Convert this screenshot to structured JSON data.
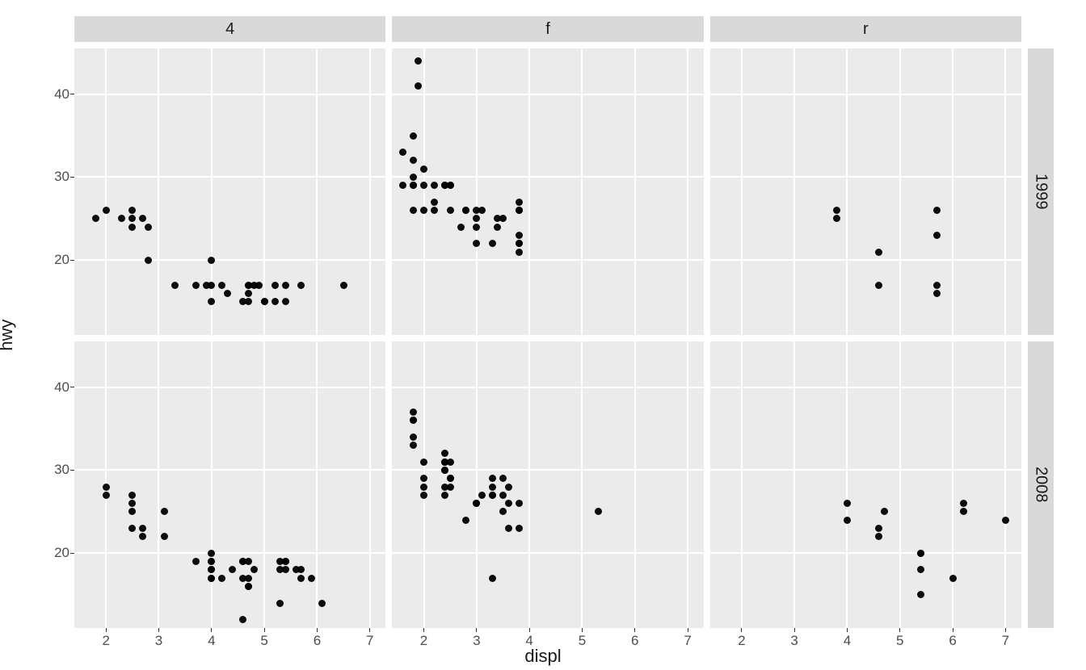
{
  "xlab": "displ",
  "ylab": "hwy",
  "strip_cols": [
    "4",
    "f",
    "r"
  ],
  "strip_rows": [
    "1999",
    "2008"
  ],
  "x_ticks": [
    2,
    3,
    4,
    5,
    6,
    7
  ],
  "y_ticks": [
    20,
    30,
    40
  ],
  "x_range": [
    1.4,
    7.3
  ],
  "y_range": [
    11,
    45.5
  ],
  "chart_data": [
    {
      "type": "scatter",
      "col": "4",
      "row": "1999",
      "xlabel": "displ",
      "ylabel": "hwy",
      "xlim": [
        1.4,
        7.3
      ],
      "ylim": [
        11,
        45.5
      ],
      "x": [
        1.8,
        2.0,
        2.3,
        2.5,
        2.5,
        2.5,
        2.7,
        2.8,
        2.8,
        3.3,
        3.7,
        3.9,
        4.0,
        4.0,
        4.0,
        4.2,
        4.3,
        4.6,
        4.7,
        4.7,
        4.7,
        4.7,
        5.0,
        5.2,
        5.2,
        5.4,
        5.4,
        5.7,
        6.5,
        4.8,
        4.9,
        5.0
      ],
      "y": [
        25,
        26,
        25,
        24,
        26,
        25,
        25,
        24,
        20,
        17,
        17,
        17,
        20,
        17,
        15,
        17,
        16,
        15,
        16,
        15,
        17,
        17,
        15,
        17,
        15,
        17,
        15,
        17,
        17,
        17,
        17,
        15
      ]
    },
    {
      "type": "scatter",
      "col": "f",
      "row": "1999",
      "xlabel": "displ",
      "ylabel": "hwy",
      "xlim": [
        1.4,
        7.3
      ],
      "ylim": [
        11,
        45.5
      ],
      "x": [
        1.6,
        1.6,
        1.8,
        1.8,
        1.8,
        1.8,
        1.8,
        1.8,
        1.8,
        1.9,
        1.9,
        2.0,
        2.0,
        2.0,
        2.2,
        2.2,
        2.2,
        2.4,
        2.4,
        2.5,
        2.5,
        2.5,
        2.7,
        2.8,
        2.8,
        3.0,
        3.0,
        3.0,
        3.0,
        3.1,
        3.3,
        3.4,
        3.4,
        3.5,
        3.8,
        3.8,
        3.8,
        3.8,
        3.8,
        3.8,
        3.8,
        3.8
      ],
      "y": [
        33,
        29,
        29,
        29,
        26,
        29,
        30,
        32,
        35,
        44,
        41,
        26,
        29,
        31,
        27,
        29,
        26,
        29,
        29,
        29,
        29,
        26,
        24,
        26,
        26,
        26,
        22,
        24,
        25,
        26,
        22,
        25,
        24,
        25,
        26,
        22,
        26,
        21,
        22,
        23,
        26,
        27
      ]
    },
    {
      "type": "scatter",
      "col": "r",
      "row": "1999",
      "xlabel": "displ",
      "ylabel": "hwy",
      "xlim": [
        1.4,
        7.3
      ],
      "ylim": [
        11,
        45.5
      ],
      "x": [
        3.8,
        3.8,
        4.6,
        4.6,
        5.7,
        5.7,
        5.7,
        5.7
      ],
      "y": [
        26,
        25,
        17,
        21,
        17,
        16,
        26,
        23
      ]
    },
    {
      "type": "scatter",
      "col": "4",
      "row": "2008",
      "xlabel": "displ",
      "ylabel": "hwy",
      "xlim": [
        1.4,
        7.3
      ],
      "ylim": [
        11,
        45.5
      ],
      "x": [
        2.0,
        2.0,
        2.5,
        2.5,
        2.5,
        2.5,
        2.7,
        2.7,
        3.1,
        3.1,
        3.7,
        4.0,
        4.0,
        4.0,
        4.0,
        4.0,
        4.0,
        4.0,
        4.2,
        4.4,
        4.6,
        4.6,
        4.6,
        4.7,
        4.7,
        4.7,
        4.7,
        4.8,
        5.3,
        5.3,
        5.3,
        5.4,
        5.4,
        5.4,
        5.6,
        5.7,
        5.7,
        5.9,
        6.1,
        4.6
      ],
      "y": [
        28,
        27,
        27,
        25,
        26,
        23,
        23,
        22,
        25,
        22,
        19,
        18,
        20,
        19,
        18,
        19,
        17,
        17,
        17,
        18,
        19,
        12,
        19,
        19,
        16,
        16,
        17,
        18,
        14,
        19,
        18,
        18,
        19,
        19,
        18,
        17,
        18,
        17,
        14,
        17
      ]
    },
    {
      "type": "scatter",
      "col": "f",
      "row": "2008",
      "xlabel": "displ",
      "ylabel": "hwy",
      "xlim": [
        1.4,
        7.3
      ],
      "ylim": [
        11,
        45.5
      ],
      "x": [
        1.8,
        1.8,
        1.8,
        1.8,
        1.8,
        2.0,
        2.0,
        2.0,
        2.0,
        2.4,
        2.4,
        2.4,
        2.4,
        2.4,
        2.4,
        2.4,
        2.4,
        2.4,
        2.5,
        2.5,
        2.5,
        2.5,
        2.8,
        3.0,
        3.0,
        3.1,
        3.3,
        3.3,
        3.3,
        3.3,
        3.3,
        3.5,
        3.5,
        3.5,
        3.6,
        3.6,
        3.6,
        3.8,
        3.8,
        5.3
      ],
      "y": [
        36,
        37,
        34,
        36,
        33,
        29,
        28,
        27,
        31,
        30,
        27,
        30,
        31,
        30,
        31,
        28,
        31,
        32,
        31,
        28,
        29,
        29,
        24,
        26,
        26,
        27,
        28,
        27,
        29,
        27,
        17,
        27,
        29,
        25,
        26,
        28,
        23,
        26,
        23,
        25
      ]
    },
    {
      "type": "scatter",
      "col": "r",
      "row": "2008",
      "xlabel": "displ",
      "ylabel": "hwy",
      "xlim": [
        1.4,
        7.3
      ],
      "ylim": [
        11,
        45.5
      ],
      "x": [
        4.0,
        4.0,
        4.6,
        4.6,
        4.7,
        5.4,
        5.4,
        5.4,
        5.4,
        6.0,
        6.2,
        6.2,
        7.0
      ],
      "y": [
        24,
        26,
        23,
        22,
        25,
        20,
        18,
        20,
        15,
        17,
        26,
        25,
        24
      ]
    }
  ]
}
